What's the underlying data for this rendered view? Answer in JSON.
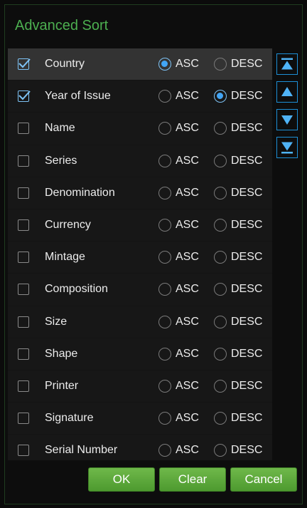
{
  "dialog": {
    "title": "Advanced Sort",
    "colors": {
      "accent": "#4caf50",
      "radio_selected": "#42a5f5",
      "button_green": "#5aa83a"
    }
  },
  "rows": [
    {
      "label": "Country",
      "checked": true,
      "order": "ASC",
      "selected": true
    },
    {
      "label": "Year of Issue",
      "checked": true,
      "order": "DESC"
    },
    {
      "label": "Name",
      "checked": false,
      "order": ""
    },
    {
      "label": "Series",
      "checked": false,
      "order": ""
    },
    {
      "label": "Denomination",
      "checked": false,
      "order": ""
    },
    {
      "label": "Currency",
      "checked": false,
      "order": ""
    },
    {
      "label": "Mintage",
      "checked": false,
      "order": ""
    },
    {
      "label": "Composition",
      "checked": false,
      "order": ""
    },
    {
      "label": "Size",
      "checked": false,
      "order": ""
    },
    {
      "label": "Shape",
      "checked": false,
      "order": ""
    },
    {
      "label": "Printer",
      "checked": false,
      "order": ""
    },
    {
      "label": "Signature",
      "checked": false,
      "order": ""
    },
    {
      "label": "Serial Number",
      "checked": false,
      "order": ""
    }
  ],
  "order_labels": {
    "asc": "ASC",
    "desc": "DESC"
  },
  "side_buttons": [
    {
      "name": "move-to-top-button",
      "icon": "move-to-top-icon"
    },
    {
      "name": "move-up-button",
      "icon": "arrow-up-icon"
    },
    {
      "name": "move-down-button",
      "icon": "arrow-down-icon"
    },
    {
      "name": "move-to-bottom-button",
      "icon": "move-to-bottom-icon"
    }
  ],
  "buttons": {
    "ok": "OK",
    "clear": "Clear",
    "cancel": "Cancel"
  }
}
